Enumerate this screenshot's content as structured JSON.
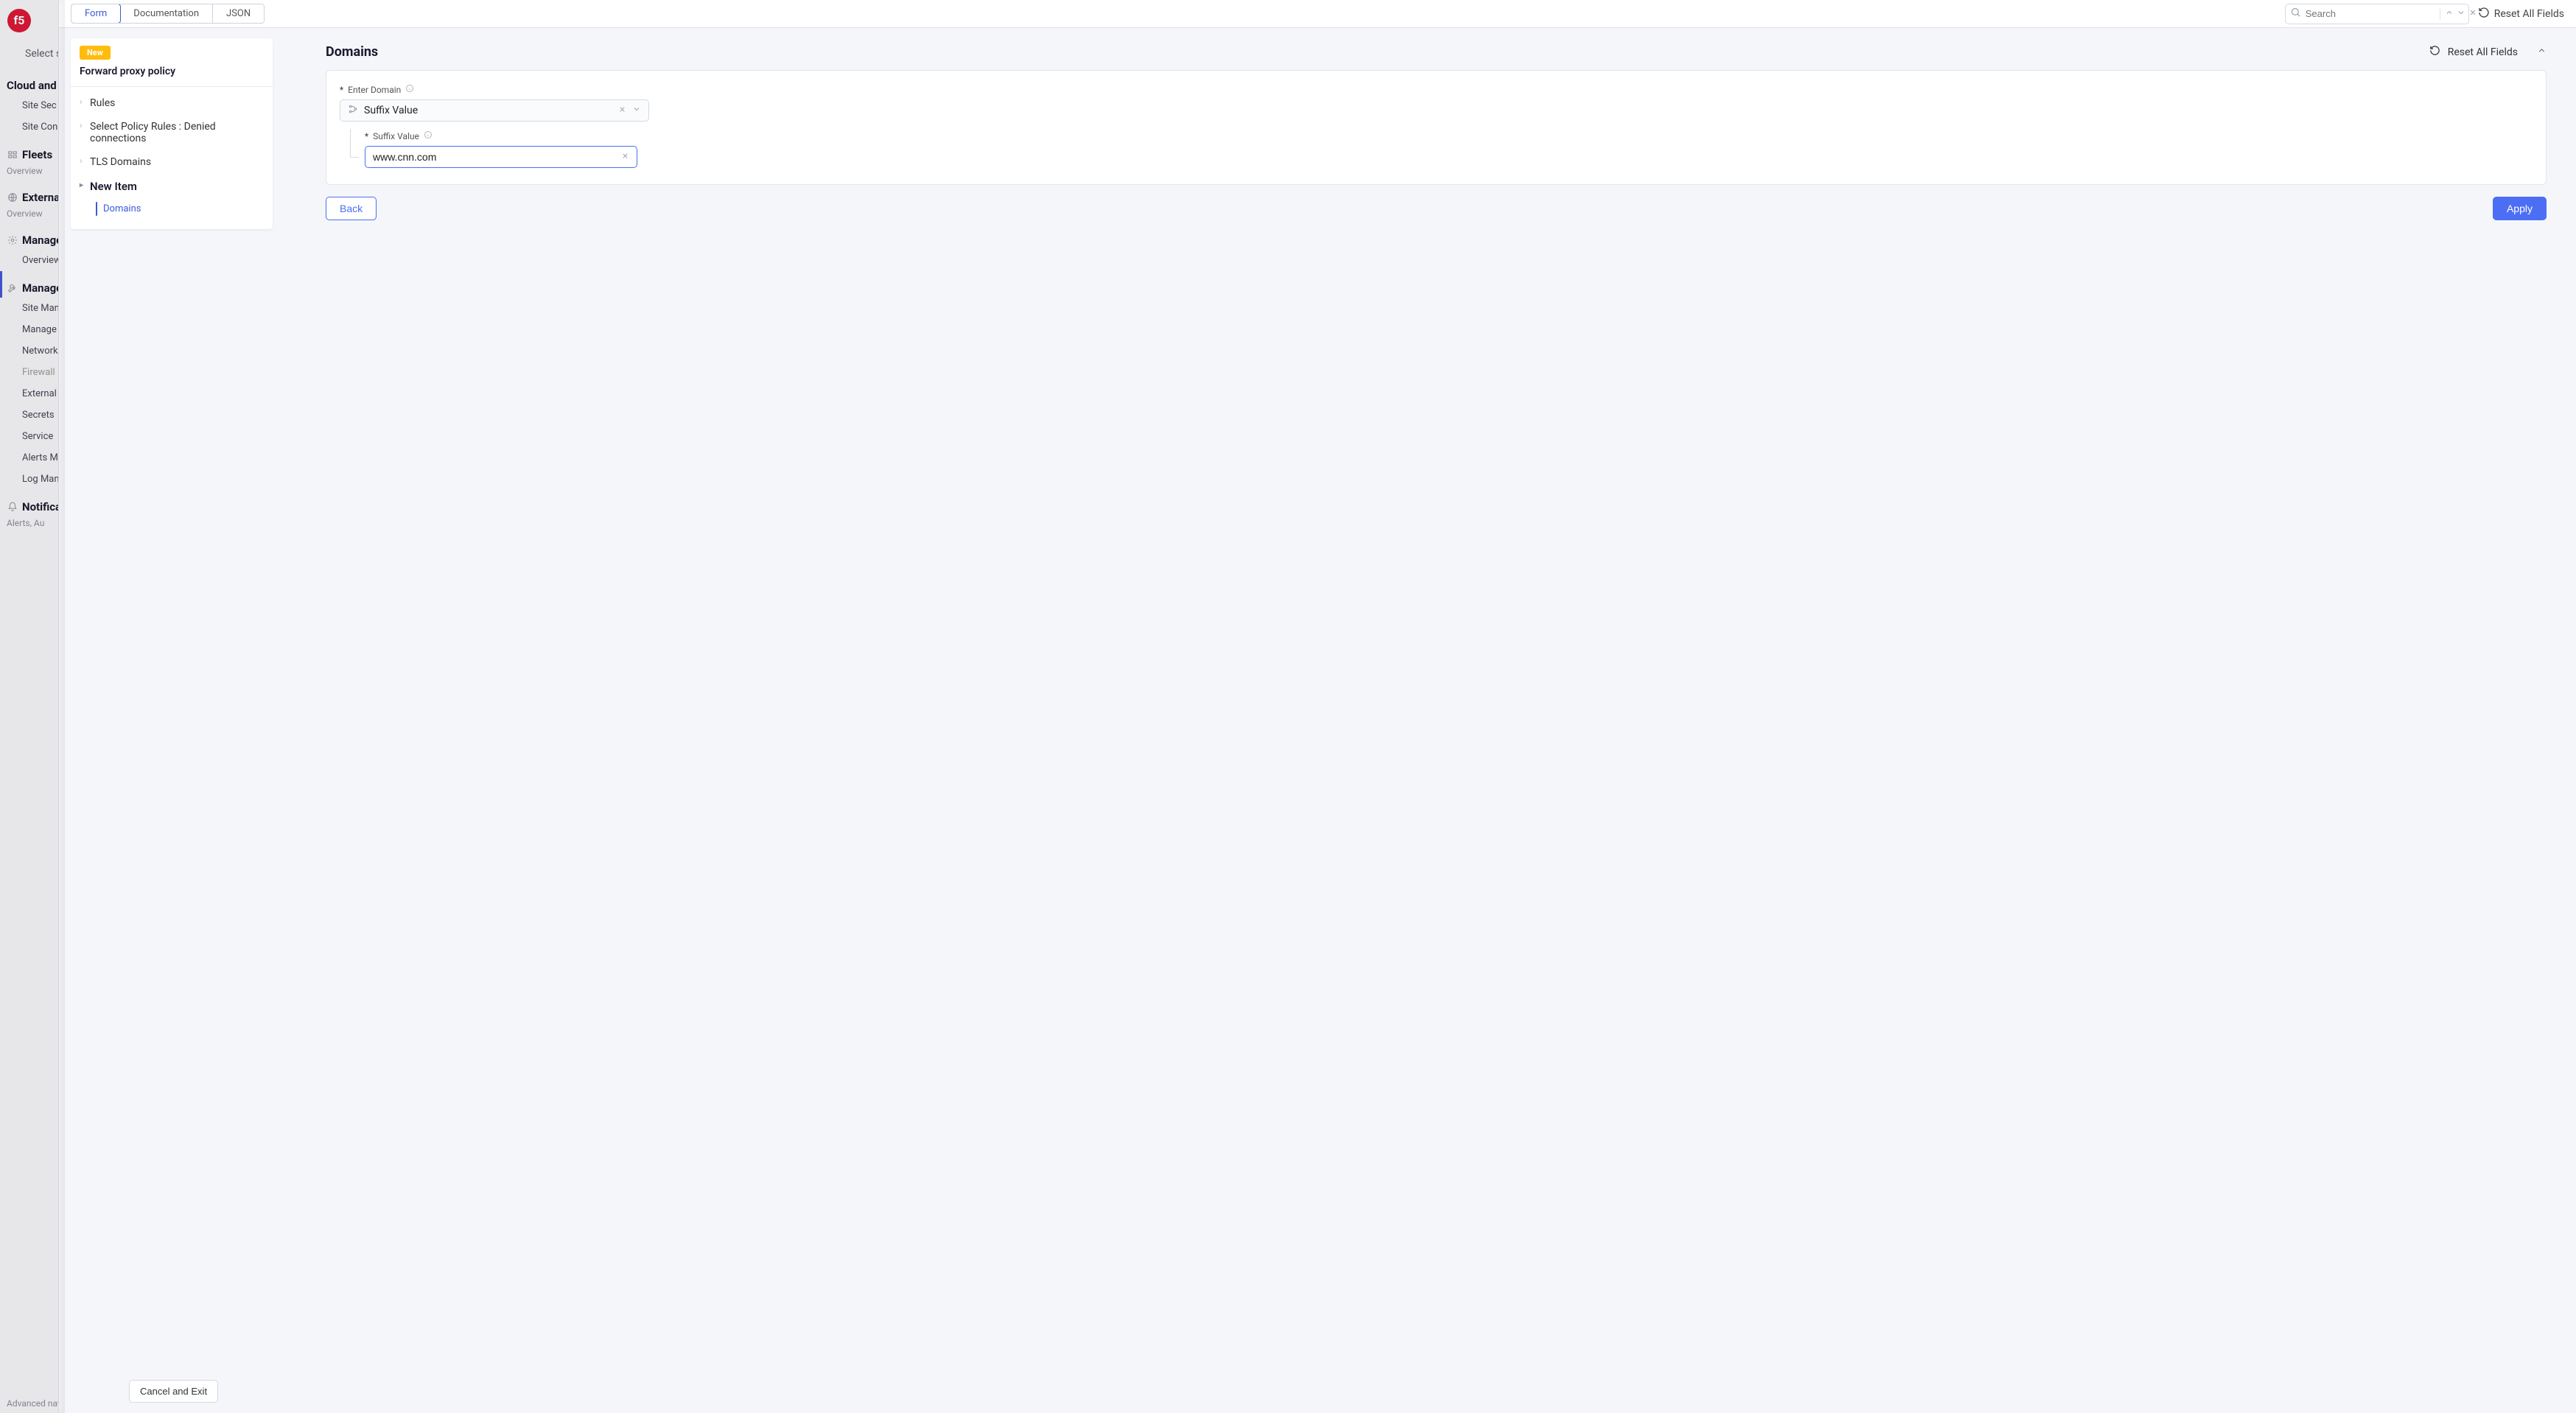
{
  "sidebar": {
    "logo_text": "f5",
    "select_service": "Select s",
    "section_cloud": "Cloud and",
    "cloud_items": [
      "Site Sec",
      "Site Con"
    ],
    "section_fleets": "Fleets",
    "fleets_sub": "Overview",
    "section_external": "Externa",
    "external_sub": "Overview",
    "section_managed1": "Manage",
    "managed1_items": [
      "Overview"
    ],
    "section_managed2": "Manage",
    "managed2_items": [
      "Site Man",
      "Manage",
      "Network",
      "Firewall",
      "External",
      "Secrets",
      "Service",
      "Alerts M",
      "Log Man"
    ],
    "section_notif": "Notifica",
    "notif_sub": "Alerts, Au",
    "advanced_nav": "Advanced nav"
  },
  "topbar": {
    "tabs": {
      "form": "Form",
      "documentation": "Documentation",
      "json": "JSON"
    },
    "search_placeholder": "Search",
    "reset_all": "Reset All Fields"
  },
  "form_nav": {
    "badge": "New",
    "title": "Forward proxy policy",
    "items": {
      "rules": "Rules",
      "select_policy": "Select Policy Rules : Denied connections",
      "tls": "TLS Domains",
      "new_item": "New Item",
      "domains_sub": "Domains"
    }
  },
  "main": {
    "title": "Domains",
    "reset_all": "Reset All Fields",
    "enter_domain_label": "Enter Domain",
    "select_value": "Suffix Value",
    "suffix_value_label": "Suffix Value",
    "suffix_input_value": "www.cnn.com",
    "back": "Back",
    "apply": "Apply"
  },
  "footer": {
    "cancel_exit": "Cancel and Exit"
  }
}
